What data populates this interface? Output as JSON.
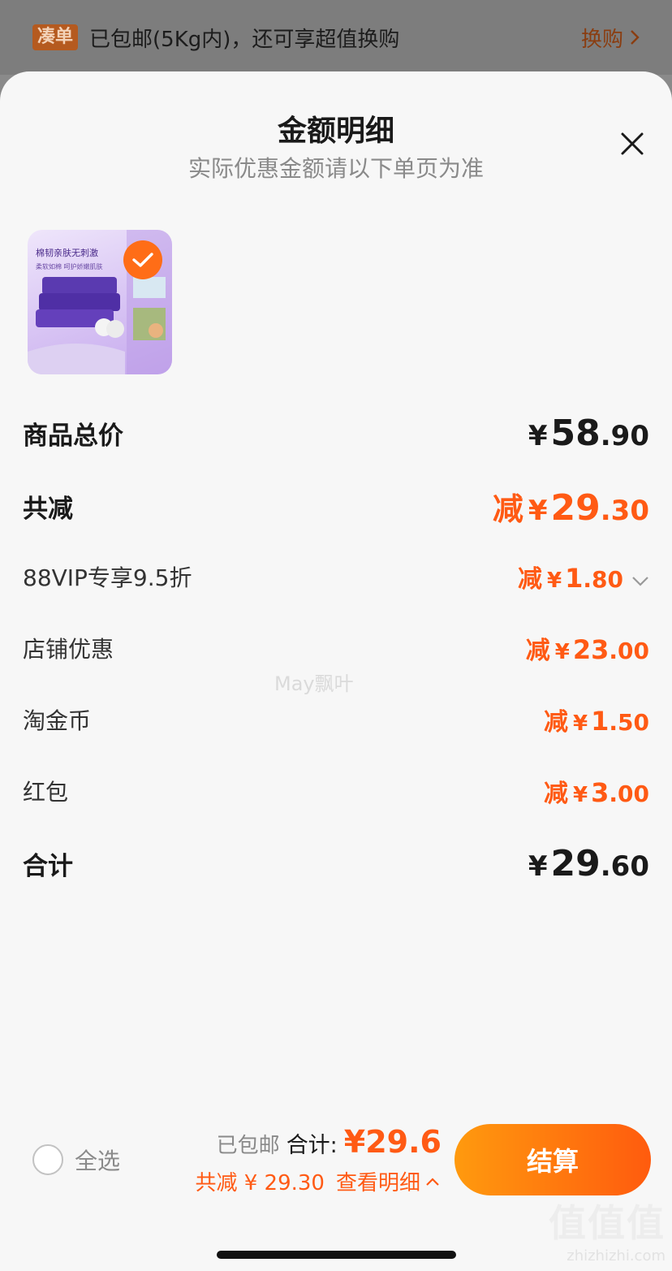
{
  "top_banner": {
    "tag": "凑单",
    "text": "已包邮(5Kg内)，还可享超值换购",
    "link": "换购"
  },
  "sheet": {
    "title": "金额明细",
    "subtitle": "实际优惠金额请以下单页为准"
  },
  "product": {
    "image_caption_1": "棉韧亲肤无刺激",
    "image_caption_2": "柔软如棉 呵护娇嫩肌肤",
    "selected": true
  },
  "rows": {
    "goods_total": {
      "label": "商品总价",
      "yen": "¥",
      "int": "58",
      "dec": ".90"
    },
    "total_discount": {
      "label": "共减",
      "pre": "减",
      "yen": "¥",
      "int": "29",
      "dec": ".30"
    },
    "vip": {
      "label": "88VIP专享9.5折",
      "pre": "减",
      "yen": "¥",
      "int": "1",
      "dec": ".80"
    },
    "store": {
      "label": "店铺优惠",
      "pre": "减",
      "yen": "¥",
      "int": "23",
      "dec": ".00"
    },
    "coins": {
      "label": "淘金币",
      "pre": "减",
      "yen": "¥",
      "int": "1",
      "dec": ".50"
    },
    "red_packet": {
      "label": "红包",
      "pre": "减",
      "yen": "¥",
      "int": "3",
      "dec": ".00"
    },
    "sum": {
      "label": "合计",
      "yen": "¥",
      "int": "29",
      "dec": ".60"
    }
  },
  "watermark": "May飘叶",
  "bottom": {
    "select_all": "全选",
    "shipping": "已包邮",
    "total_label": "合计:",
    "total_value": "¥29.6",
    "saved": "共减 ¥ 29.30",
    "detail_link": "查看明细",
    "checkout": "结算"
  },
  "brand_watermark": {
    "big": "值值值",
    "small": "zhizhizhi.com"
  },
  "colors": {
    "accent": "#ff5a14",
    "button_start": "#ff9a0e",
    "button_end": "#ff5b0e"
  }
}
